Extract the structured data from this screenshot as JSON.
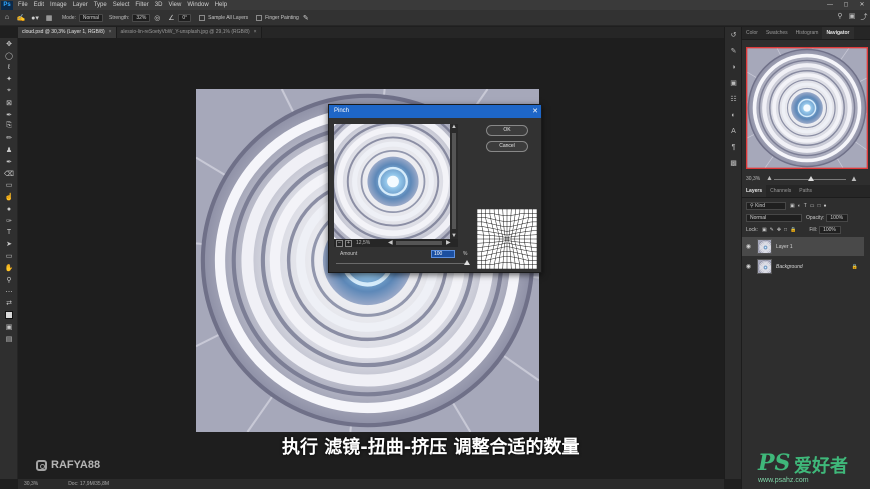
{
  "menubar": {
    "items": [
      "File",
      "Edit",
      "Image",
      "Layer",
      "Type",
      "Select",
      "Filter",
      "3D",
      "View",
      "Window",
      "Help"
    ],
    "logo": "Ps"
  },
  "options": {
    "mode_label": "Mode:",
    "mode_value": "Normal",
    "strength_label": "Strength:",
    "strength_value": "32%",
    "angle_value": "0°",
    "sample_all_layers": "Sample All Layers",
    "finger_painting": "Finger Painting"
  },
  "tabs": [
    {
      "label": "cloud.psd @ 30,3% (Layer 1, RGB/8)",
      "active": true
    },
    {
      "label": "alessio-lin-reSoetyVbW_Y-unsplash.jpg @ 29,1% (RGB/8)",
      "active": false
    }
  ],
  "statusbar": {
    "zoom": "30,3%",
    "doc": "Doc: 17,9M/35,8M"
  },
  "panels": {
    "top_tabs": [
      "Color",
      "Swatches",
      "Histogram",
      "Navigator"
    ],
    "active_top": "Navigator",
    "nav_zoom": "30,3%",
    "layer_tabs": [
      "Layers",
      "Channels",
      "Paths"
    ],
    "active_layer_tab": "Layers",
    "kind_label": "Kind",
    "blend_mode": "Normal",
    "opacity_label": "Opacity:",
    "opacity_value": "100%",
    "lock_label": "Lock:",
    "fill_label": "Fill:",
    "fill_value": "100%",
    "layers": [
      {
        "name": "Layer 1",
        "selected": true
      },
      {
        "name": "Background",
        "selected": false,
        "locked": true
      }
    ]
  },
  "dialog": {
    "title": "Pinch",
    "ok_label": "OK",
    "cancel_label": "Cancel",
    "zoom_value": "12,5%",
    "amount_label": "Amount",
    "amount_value": "100",
    "amount_unit": "%",
    "amount_fraction": 1.0
  },
  "subtitle": "执行 滤镜-扭曲-挤压 调整合适的数量",
  "watermarks": {
    "rafya": "RAFYA88",
    "ps_mark": "PS",
    "ps_cn": "爱好者",
    "ps_url": "www.psahz.com"
  },
  "colors": {
    "accent": "#1e66c7",
    "sky": "#a7a9ba",
    "watermark_green": "#3fb87a"
  }
}
